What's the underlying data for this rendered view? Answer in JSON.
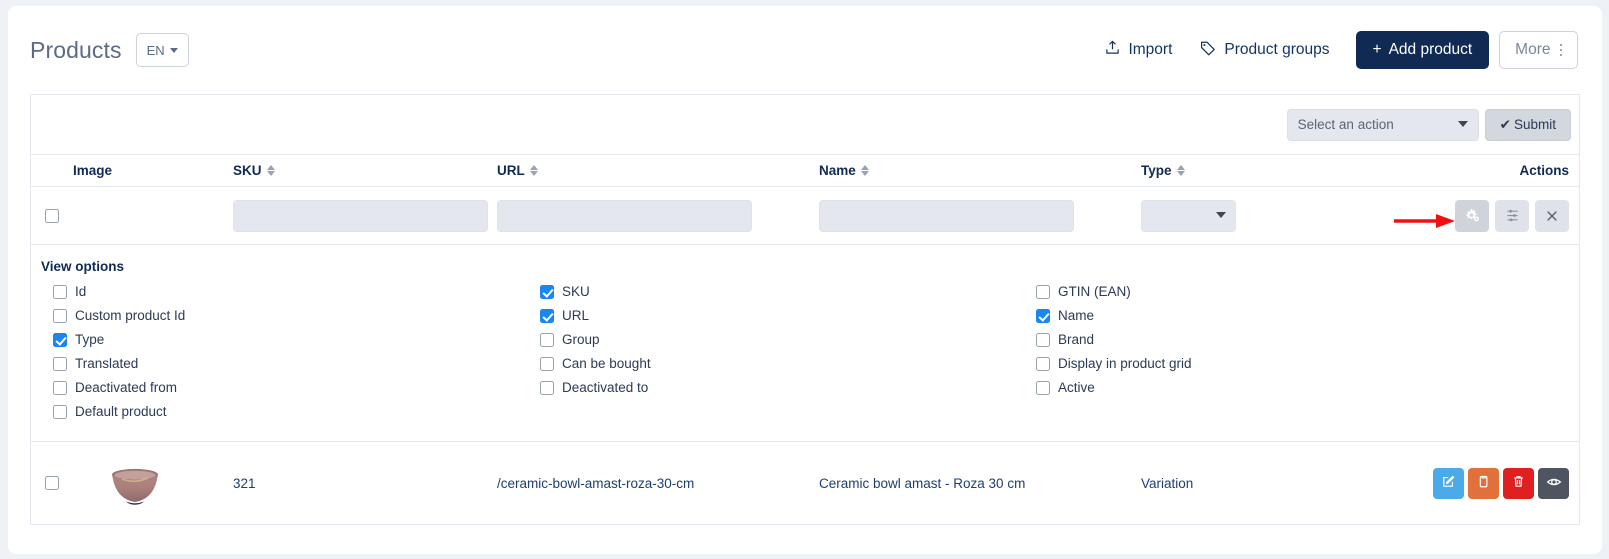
{
  "header": {
    "title": "Products",
    "language_button": "EN",
    "import_label": "Import",
    "product_groups_label": "Product groups",
    "add_product_label": "Add product",
    "add_product_plus": "+",
    "more_label": "More"
  },
  "bulk": {
    "select_action_value": "Select an action",
    "submit_label": "Submit",
    "submit_check": "✔"
  },
  "table": {
    "headers": {
      "image": "Image",
      "sku": "SKU",
      "url": "URL",
      "name": "Name",
      "type": "Type",
      "actions": "Actions"
    },
    "filter_row": {
      "sku_value": "",
      "url_value": "",
      "name_value": "",
      "type_value": ""
    },
    "rows": [
      {
        "sku": "321",
        "url": "/ceramic-bowl-amast-roza-30-cm",
        "name": "Ceramic bowl amast - Roza 30 cm",
        "type": "Variation"
      }
    ]
  },
  "view_options": {
    "title": "View options",
    "columns": [
      [
        {
          "label": "Id",
          "checked": false
        },
        {
          "label": "Custom product Id",
          "checked": false
        },
        {
          "label": "Type",
          "checked": true
        },
        {
          "label": "Translated",
          "checked": false
        },
        {
          "label": "Deactivated from",
          "checked": false
        },
        {
          "label": "Default product",
          "checked": false
        }
      ],
      [
        {
          "label": "SKU",
          "checked": true
        },
        {
          "label": "URL",
          "checked": true
        },
        {
          "label": "Group",
          "checked": false
        },
        {
          "label": "Can be bought",
          "checked": false
        },
        {
          "label": "Deactivated to",
          "checked": false
        }
      ],
      [
        {
          "label": "GTIN (EAN)",
          "checked": false
        },
        {
          "label": "Name",
          "checked": true
        },
        {
          "label": "Brand",
          "checked": false
        },
        {
          "label": "Display in product grid",
          "checked": false
        },
        {
          "label": "Active",
          "checked": false
        }
      ]
    ]
  },
  "icons": {
    "import": "upload-icon",
    "product_groups": "tag-icon",
    "more": "vertical-dots-icon",
    "filter_settings": "cogs-icon",
    "filter_sliders": "sliders-icon",
    "filter_clear": "close-x-icon",
    "row_edit": "pencil-square-icon",
    "row_copy": "copy-icon",
    "row_delete": "trash-icon",
    "row_preview": "eye-icon",
    "annotation": "red-arrow-pointer"
  },
  "colors": {
    "brand_navy": "#102a54",
    "accent_blue": "#1a86f0",
    "edit_blue": "#4aabe8",
    "copy_orange": "#e2703a",
    "delete_red": "#e02020",
    "preview_gray": "#4e5560",
    "annotation_red": "#ee1111",
    "page_bg": "#eef1f6"
  }
}
